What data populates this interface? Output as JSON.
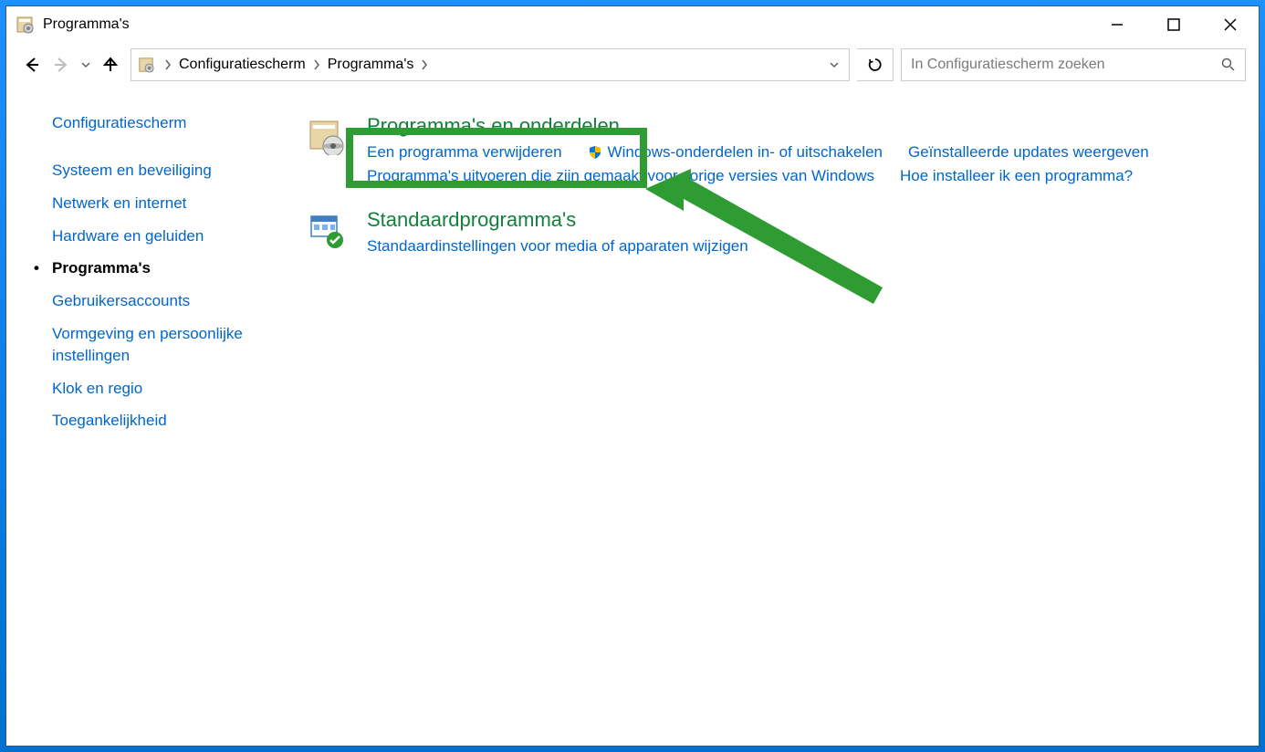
{
  "window": {
    "title": "Programma's"
  },
  "breadcrumb": {
    "items": [
      "Configuratiescherm",
      "Programma's"
    ]
  },
  "search": {
    "placeholder": "In Configuratiescherm zoeken"
  },
  "sidebar": {
    "home": "Configuratiescherm",
    "items": [
      "Systeem en beveiliging",
      "Netwerk en internet",
      "Hardware en geluiden",
      "Programma's",
      "Gebruikersaccounts",
      "Vormgeving en persoonlijke instellingen",
      "Klok en regio",
      "Toegankelijkheid"
    ],
    "active_index": 3
  },
  "main": {
    "categories": [
      {
        "title": "Programma's en onderdelen",
        "links": [
          "Een programma verwijderen",
          "Windows-onderdelen in- of uitschakelen",
          "Geïnstalleerde updates weergeven",
          "Programma's uitvoeren die zijn gemaakt voor vorige versies van Windows",
          "Hoe installeer ik een programma?"
        ]
      },
      {
        "title": "Standaardprogramma's",
        "links": [
          "Standaardinstellingen voor media of apparaten wijzigen"
        ]
      }
    ]
  },
  "annotation": {
    "highlighted_link": "Geïnstalleerde updates weergeven"
  }
}
